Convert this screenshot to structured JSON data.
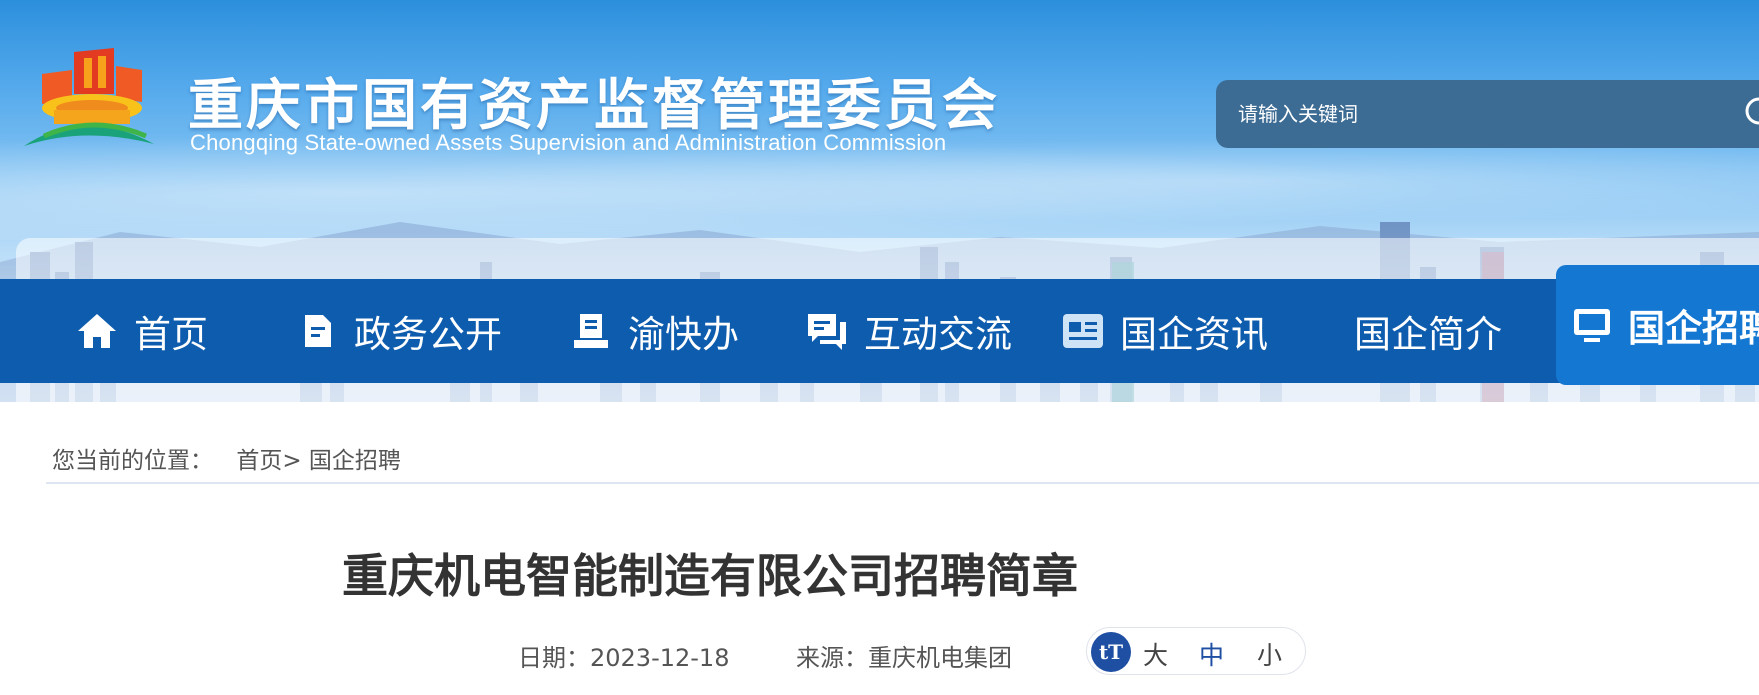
{
  "header": {
    "title_cn": "重庆市国有资产监督管理委员会",
    "title_en": "Chongqing State-owned Assets Supervision and Administration Commission",
    "logo_icon": "sasac-chongqing-logo"
  },
  "search": {
    "placeholder": "请输入关键词",
    "icon": "search-icon"
  },
  "nav": {
    "items": [
      {
        "label": "首页",
        "icon": "home-icon"
      },
      {
        "label": "政务公开",
        "icon": "document-icon"
      },
      {
        "label": "渝快办",
        "icon": "book-icon"
      },
      {
        "label": "互动交流",
        "icon": "chat-icon"
      },
      {
        "label": "国企资讯",
        "icon": "news-icon"
      },
      {
        "label": "国企简介",
        "icon": ""
      },
      {
        "label": "国企招聘",
        "icon": "monitor-icon",
        "active": true
      }
    ],
    "bar_color": "#0e5cae",
    "active_color": "#1477d2"
  },
  "breadcrumb": {
    "label": "您当前的位置：",
    "home": "首页>",
    "current": "国企招聘"
  },
  "article": {
    "title": "重庆机电智能制造有限公司招聘简章",
    "date": "日期：2023-12-18",
    "source": "来源：重庆机电集团"
  },
  "font_size": {
    "icon": "tT",
    "large": "大",
    "medium": "中",
    "small": "小"
  }
}
